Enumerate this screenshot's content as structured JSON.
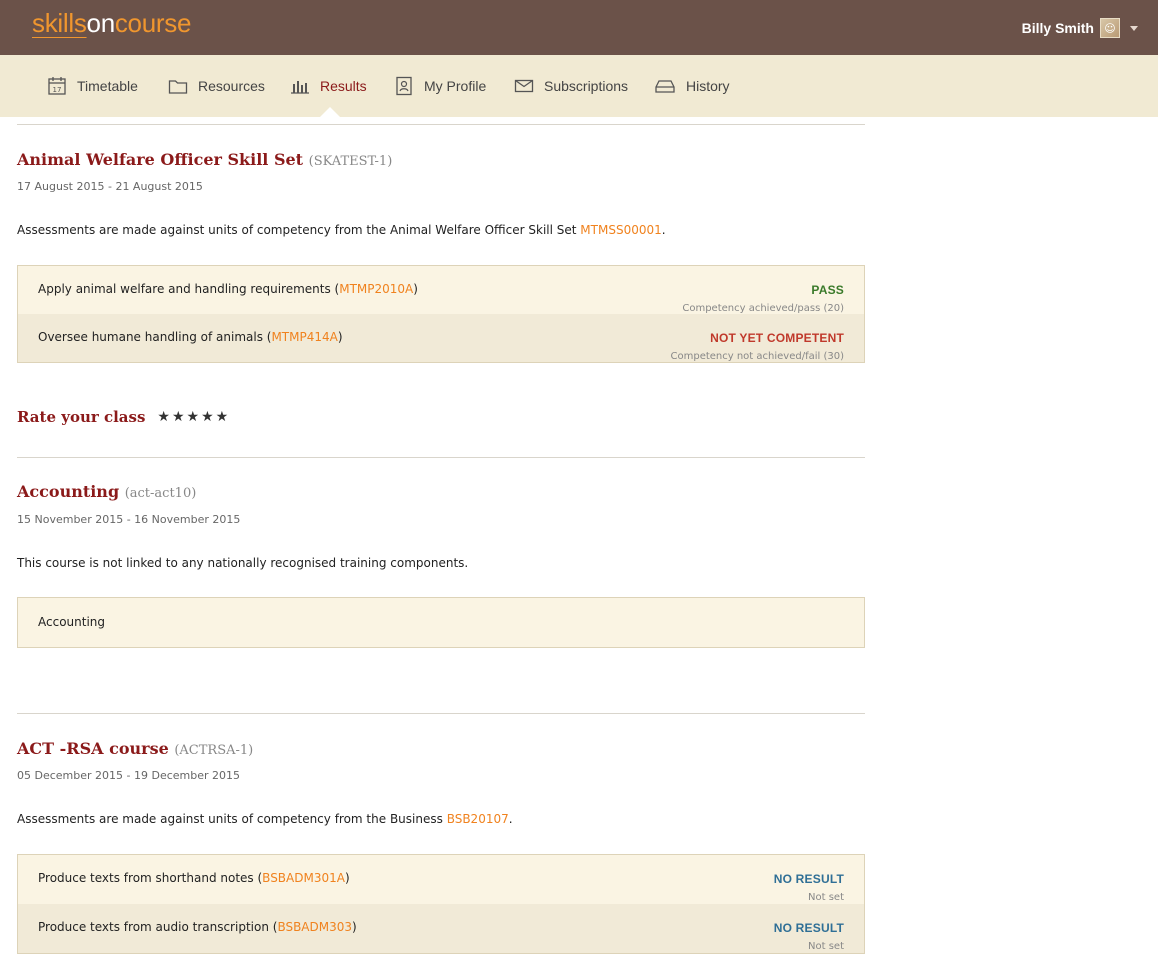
{
  "brand": {
    "part1": "skills",
    "part2": "on",
    "part3": "course"
  },
  "user": {
    "name": "Billy Smith"
  },
  "nav": {
    "items": [
      {
        "label": "Timetable",
        "icon": "calendar-icon"
      },
      {
        "label": "Resources",
        "icon": "folder-icon"
      },
      {
        "label": "Results",
        "icon": "bar-chart-icon",
        "active": true
      },
      {
        "label": "My Profile",
        "icon": "profile-icon"
      },
      {
        "label": "Subscriptions",
        "icon": "envelope-icon"
      },
      {
        "label": "History",
        "icon": "inbox-icon"
      }
    ]
  },
  "courses": [
    {
      "title": "Animal Welfare Officer Skill Set",
      "code": "(SKATEST-1)",
      "dates": "17 August 2015 - 21 August 2015",
      "desc_prefix": "Assessments are made against units of competency from the Animal Welfare Officer Skill Set ",
      "desc_link": "MTMSS00001",
      "desc_suffix": ".",
      "units": [
        {
          "name": "Apply animal welfare and handling requirements (",
          "code": "MTMP2010A",
          "close": ")",
          "result": "PASS",
          "detail": "Competency achieved/pass (20)"
        },
        {
          "name": "Oversee humane handling of animals (",
          "code": "MTMP414A",
          "close": ")",
          "result": "NOT YET COMPETENT",
          "detail": "Competency not achieved/fail (30)"
        }
      ]
    },
    {
      "title": "Accounting",
      "code": "(act-act10)",
      "dates": "15 November 2015 - 16 November 2015",
      "desc": "This course is not linked to any nationally recognised training components.",
      "units": [
        {
          "name": "Accounting"
        }
      ]
    },
    {
      "title": "ACT -RSA course",
      "code": "(ACTRSA-1)",
      "dates": "05 December 2015 - 19 December 2015",
      "desc_prefix": "Assessments are made against units of competency from the Business ",
      "desc_link": "BSB20107",
      "desc_suffix": ".",
      "units": [
        {
          "name": "Produce texts from shorthand notes (",
          "code": "BSBADM301A",
          "close": ")",
          "result": "NO RESULT",
          "detail": "Not set"
        },
        {
          "name": "Produce texts from audio transcription (",
          "code": "BSBADM303",
          "close": ")",
          "result": "NO RESULT",
          "detail": "Not set"
        }
      ]
    }
  ],
  "rating": {
    "label": "Rate your class",
    "stars": "★★★★★"
  },
  "colors": {
    "header": "#6b5249",
    "nav": "#f1ead3",
    "accent": "#8b1a1a",
    "link": "#f0821e",
    "pass": "#3a7a2a",
    "fail": "#c0392b",
    "none": "#2f6f96"
  }
}
